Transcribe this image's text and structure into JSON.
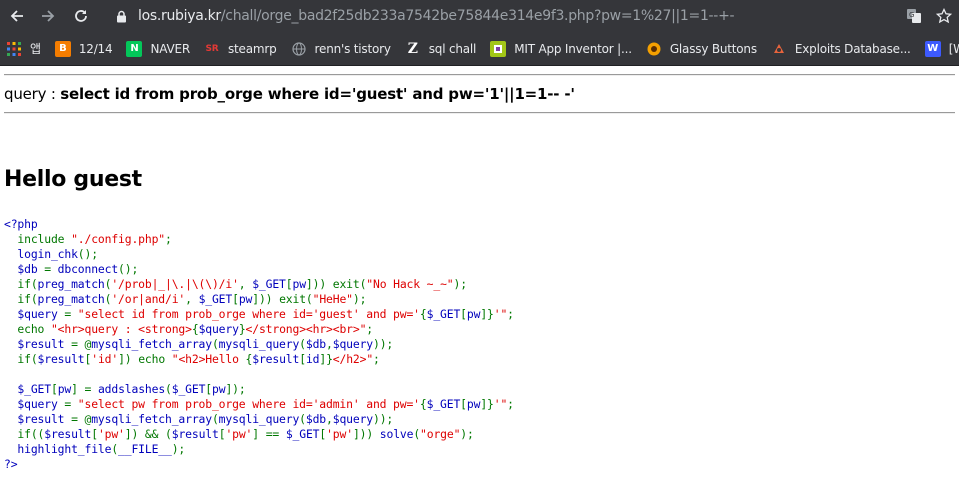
{
  "browser": {
    "url_host": "los.rubiya.kr",
    "url_path": "/chall/orge_bad2f25db233a7542be75844e314e9f3.php?pw=1%27||1=1--+-"
  },
  "bookmarks": [
    {
      "label": "앱",
      "icon": "apps-grid-icon",
      "color": "#e8eaed"
    },
    {
      "label": "12/14",
      "icon": "blogger-icon",
      "color": "#f57d00"
    },
    {
      "label": "NAVER",
      "icon": "naver-icon",
      "color": "#03c75a"
    },
    {
      "label": "steamrp",
      "icon": "steamrp-icon",
      "color": "#c62828"
    },
    {
      "label": "renn's tistory",
      "icon": "globe-icon",
      "color": "#9aa0a6"
    },
    {
      "label": "sql chall",
      "icon": "z-icon",
      "color": "#ffffff"
    },
    {
      "label": "MIT App Inventor |...",
      "icon": "mit-app-inventor-icon",
      "color": "#a2c617"
    },
    {
      "label": "Glassy Buttons",
      "icon": "glassy-buttons-icon",
      "color": "#f4a000"
    },
    {
      "label": "Exploits Database...",
      "icon": "exploit-db-icon",
      "color": "#e8643c"
    },
    {
      "label": "[W",
      "icon": "bookmark-icon",
      "color": "#3d5afe"
    }
  ],
  "page": {
    "query_prefix": "query : ",
    "query_text": "select id from prob_orge where id='guest' and pw='1'||1=1-- -'",
    "hello": "Hello guest",
    "source_lines": [
      [
        {
          "t": "<?php",
          "c": "c-def"
        }
      ],
      [
        {
          "t": "  include ",
          "c": "c-kw"
        },
        {
          "t": "\"./config.php\"",
          "c": "c-str"
        },
        {
          "t": ";",
          "c": "c-kw"
        }
      ],
      [
        {
          "t": "  login_chk",
          "c": "c-def"
        },
        {
          "t": "();",
          "c": "c-kw"
        }
      ],
      [
        {
          "t": "  $db ",
          "c": "c-def"
        },
        {
          "t": "= ",
          "c": "c-kw"
        },
        {
          "t": "dbconnect",
          "c": "c-def"
        },
        {
          "t": "();",
          "c": "c-kw"
        }
      ],
      [
        {
          "t": "  if(",
          "c": "c-kw"
        },
        {
          "t": "preg_match",
          "c": "c-def"
        },
        {
          "t": "(",
          "c": "c-kw"
        },
        {
          "t": "'/prob|_|\\.|\\(\\)/i'",
          "c": "c-str"
        },
        {
          "t": ", ",
          "c": "c-kw"
        },
        {
          "t": "$_GET",
          "c": "c-def"
        },
        {
          "t": "[",
          "c": "c-kw"
        },
        {
          "t": "pw",
          "c": "c-def"
        },
        {
          "t": "])) exit(",
          "c": "c-kw"
        },
        {
          "t": "\"No Hack ~_~\"",
          "c": "c-str"
        },
        {
          "t": ");",
          "c": "c-kw"
        }
      ],
      [
        {
          "t": "  if(",
          "c": "c-kw"
        },
        {
          "t": "preg_match",
          "c": "c-def"
        },
        {
          "t": "(",
          "c": "c-kw"
        },
        {
          "t": "'/or|and/i'",
          "c": "c-str"
        },
        {
          "t": ", ",
          "c": "c-kw"
        },
        {
          "t": "$_GET",
          "c": "c-def"
        },
        {
          "t": "[",
          "c": "c-kw"
        },
        {
          "t": "pw",
          "c": "c-def"
        },
        {
          "t": "])) exit(",
          "c": "c-kw"
        },
        {
          "t": "\"HeHe\"",
          "c": "c-str"
        },
        {
          "t": ");",
          "c": "c-kw"
        }
      ],
      [
        {
          "t": "  $query ",
          "c": "c-def"
        },
        {
          "t": "= ",
          "c": "c-kw"
        },
        {
          "t": "\"select id from prob_orge where id='guest' and pw='",
          "c": "c-str"
        },
        {
          "t": "{",
          "c": "c-kw"
        },
        {
          "t": "$_GET",
          "c": "c-def"
        },
        {
          "t": "[",
          "c": "c-kw"
        },
        {
          "t": "pw",
          "c": "c-def"
        },
        {
          "t": "]}",
          "c": "c-kw"
        },
        {
          "t": "'\"",
          "c": "c-str"
        },
        {
          "t": ";",
          "c": "c-kw"
        }
      ],
      [
        {
          "t": "  echo ",
          "c": "c-kw"
        },
        {
          "t": "\"<hr>query : <strong>",
          "c": "c-str"
        },
        {
          "t": "{",
          "c": "c-kw"
        },
        {
          "t": "$query",
          "c": "c-def"
        },
        {
          "t": "}",
          "c": "c-kw"
        },
        {
          "t": "</strong><hr><br>\"",
          "c": "c-str"
        },
        {
          "t": ";",
          "c": "c-kw"
        }
      ],
      [
        {
          "t": "  $result ",
          "c": "c-def"
        },
        {
          "t": "= @",
          "c": "c-kw"
        },
        {
          "t": "mysqli_fetch_array",
          "c": "c-def"
        },
        {
          "t": "(",
          "c": "c-kw"
        },
        {
          "t": "mysqli_query",
          "c": "c-def"
        },
        {
          "t": "(",
          "c": "c-kw"
        },
        {
          "t": "$db",
          "c": "c-def"
        },
        {
          "t": ",",
          "c": "c-kw"
        },
        {
          "t": "$query",
          "c": "c-def"
        },
        {
          "t": "));",
          "c": "c-kw"
        }
      ],
      [
        {
          "t": "  if(",
          "c": "c-kw"
        },
        {
          "t": "$result",
          "c": "c-def"
        },
        {
          "t": "[",
          "c": "c-kw"
        },
        {
          "t": "'id'",
          "c": "c-str"
        },
        {
          "t": "]) echo ",
          "c": "c-kw"
        },
        {
          "t": "\"<h2>Hello ",
          "c": "c-str"
        },
        {
          "t": "{",
          "c": "c-kw"
        },
        {
          "t": "$result",
          "c": "c-def"
        },
        {
          "t": "[",
          "c": "c-kw"
        },
        {
          "t": "id",
          "c": "c-def"
        },
        {
          "t": "]}",
          "c": "c-kw"
        },
        {
          "t": "</h2>\"",
          "c": "c-str"
        },
        {
          "t": ";",
          "c": "c-kw"
        }
      ],
      [
        {
          "t": "",
          "c": "c-kw"
        }
      ],
      [
        {
          "t": "  $_GET",
          "c": "c-def"
        },
        {
          "t": "[",
          "c": "c-kw"
        },
        {
          "t": "pw",
          "c": "c-def"
        },
        {
          "t": "] = ",
          "c": "c-kw"
        },
        {
          "t": "addslashes",
          "c": "c-def"
        },
        {
          "t": "(",
          "c": "c-kw"
        },
        {
          "t": "$_GET",
          "c": "c-def"
        },
        {
          "t": "[",
          "c": "c-kw"
        },
        {
          "t": "pw",
          "c": "c-def"
        },
        {
          "t": "]);",
          "c": "c-kw"
        }
      ],
      [
        {
          "t": "  $query ",
          "c": "c-def"
        },
        {
          "t": "= ",
          "c": "c-kw"
        },
        {
          "t": "\"select pw from prob_orge where id='admin' and pw='",
          "c": "c-str"
        },
        {
          "t": "{",
          "c": "c-kw"
        },
        {
          "t": "$_GET",
          "c": "c-def"
        },
        {
          "t": "[",
          "c": "c-kw"
        },
        {
          "t": "pw",
          "c": "c-def"
        },
        {
          "t": "]}",
          "c": "c-kw"
        },
        {
          "t": "'\"",
          "c": "c-str"
        },
        {
          "t": ";",
          "c": "c-kw"
        }
      ],
      [
        {
          "t": "  $result ",
          "c": "c-def"
        },
        {
          "t": "= @",
          "c": "c-kw"
        },
        {
          "t": "mysqli_fetch_array",
          "c": "c-def"
        },
        {
          "t": "(",
          "c": "c-kw"
        },
        {
          "t": "mysqli_query",
          "c": "c-def"
        },
        {
          "t": "(",
          "c": "c-kw"
        },
        {
          "t": "$db",
          "c": "c-def"
        },
        {
          "t": ",",
          "c": "c-kw"
        },
        {
          "t": "$query",
          "c": "c-def"
        },
        {
          "t": "));",
          "c": "c-kw"
        }
      ],
      [
        {
          "t": "  if((",
          "c": "c-kw"
        },
        {
          "t": "$result",
          "c": "c-def"
        },
        {
          "t": "[",
          "c": "c-kw"
        },
        {
          "t": "'pw'",
          "c": "c-str"
        },
        {
          "t": "]) && (",
          "c": "c-kw"
        },
        {
          "t": "$result",
          "c": "c-def"
        },
        {
          "t": "[",
          "c": "c-kw"
        },
        {
          "t": "'pw'",
          "c": "c-str"
        },
        {
          "t": "] == ",
          "c": "c-kw"
        },
        {
          "t": "$_GET",
          "c": "c-def"
        },
        {
          "t": "[",
          "c": "c-kw"
        },
        {
          "t": "'pw'",
          "c": "c-str"
        },
        {
          "t": "])) ",
          "c": "c-kw"
        },
        {
          "t": "solve",
          "c": "c-def"
        },
        {
          "t": "(",
          "c": "c-kw"
        },
        {
          "t": "\"orge\"",
          "c": "c-str"
        },
        {
          "t": ");",
          "c": "c-kw"
        }
      ],
      [
        {
          "t": "  highlight_file",
          "c": "c-def"
        },
        {
          "t": "(",
          "c": "c-kw"
        },
        {
          "t": "__FILE__",
          "c": "c-def"
        },
        {
          "t": ");",
          "c": "c-kw"
        }
      ],
      [
        {
          "t": "?>",
          "c": "c-def"
        }
      ]
    ]
  }
}
